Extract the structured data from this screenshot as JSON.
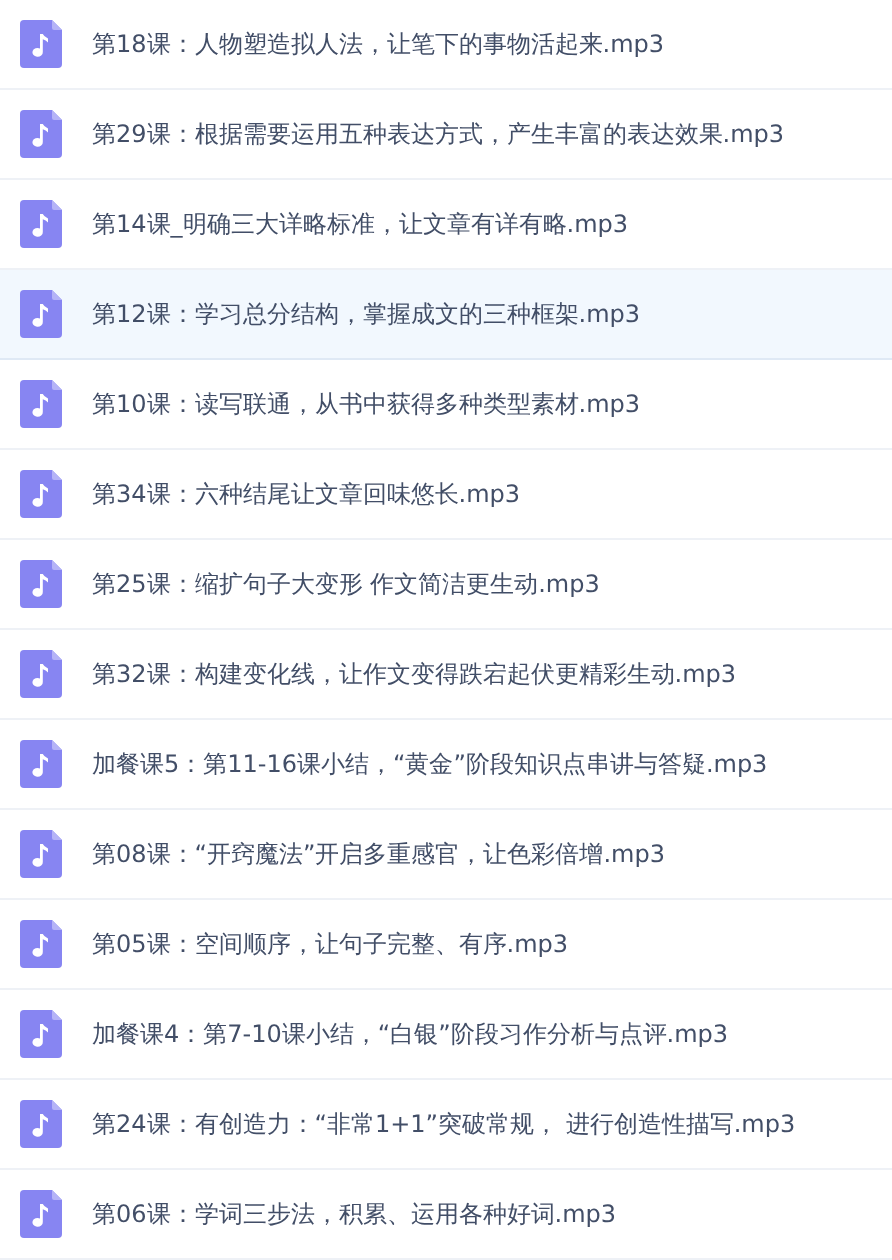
{
  "files": [
    {
      "name": "第18课：人物塑造拟人法，让笔下的事物活起来.mp3",
      "selected": false
    },
    {
      "name": "第29课：根据需要运用五种表达方式，产生丰富的表达效果.mp3",
      "selected": false
    },
    {
      "name": "第14课_明确三大详略标准，让文章有详有略.mp3",
      "selected": false
    },
    {
      "name": "第12课：学习总分结构，掌握成文的三种框架.mp3",
      "selected": true
    },
    {
      "name": "第10课：读写联通，从书中获得多种类型素材.mp3",
      "selected": false
    },
    {
      "name": "第34课：六种结尾让文章回味悠长.mp3",
      "selected": false
    },
    {
      "name": "第25课：缩扩句子大变形 作文简洁更生动.mp3",
      "selected": false
    },
    {
      "name": "第32课：构建变化线，让作文变得跌宕起伏更精彩生动.mp3",
      "selected": false
    },
    {
      "name": "加餐课5：第11-16课小结，“黄金”阶段知识点串讲与答疑.mp3",
      "selected": false
    },
    {
      "name": "第08课：“开窍魔法”开启多重感官，让色彩倍增.mp3",
      "selected": false
    },
    {
      "name": "第05课：空间顺序，让句子完整、有序.mp3",
      "selected": false
    },
    {
      "name": "加餐课4：第7-10课小结，“白银”阶段习作分析与点评.mp3",
      "selected": false
    },
    {
      "name": "第24课：有创造力：“非常1+1”突破常规， 进行创造性描写.mp3",
      "selected": false
    },
    {
      "name": "第06课：学词三步法，积累、运用各种好词.mp3",
      "selected": false
    }
  ]
}
